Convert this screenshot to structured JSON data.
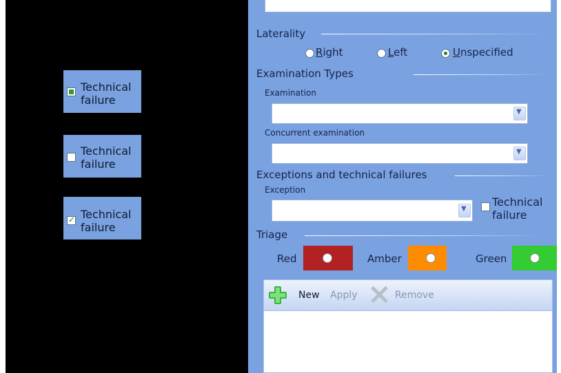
{
  "left_panel": {
    "checkbox_cards": [
      {
        "label": "Technical\nfailure",
        "state": "indeterminate"
      },
      {
        "label": "Technical\nfailure",
        "state": "unchecked"
      },
      {
        "label": "Technical\nfailure",
        "state": "checked"
      }
    ]
  },
  "laterality": {
    "title": "Laterality",
    "options": [
      "Right",
      "Left",
      "Unspecified"
    ],
    "selected": "Unspecified"
  },
  "examination_types": {
    "title": "Examination Types",
    "examination_label": "Examination",
    "examination_value": "",
    "concurrent_label": "Concurrent examination",
    "concurrent_value": ""
  },
  "exceptions": {
    "title": "Exceptions and technical failures",
    "exception_label": "Exception",
    "exception_value": "",
    "technical_failure_label": "Technical\nfailure",
    "technical_failure_checked": false
  },
  "triage": {
    "title": "Triage",
    "options": [
      {
        "label": "Red",
        "color": "#b22222"
      },
      {
        "label": "Amber",
        "color": "#ff8c00"
      },
      {
        "label": "Green",
        "color": "#33cc33"
      }
    ]
  },
  "toolbar": {
    "new_label": "New",
    "apply_label": "Apply",
    "remove_label": "Remove"
  },
  "colors": {
    "panel_blue": "#7aa1e0",
    "accent_green": "#2f7a2f"
  }
}
